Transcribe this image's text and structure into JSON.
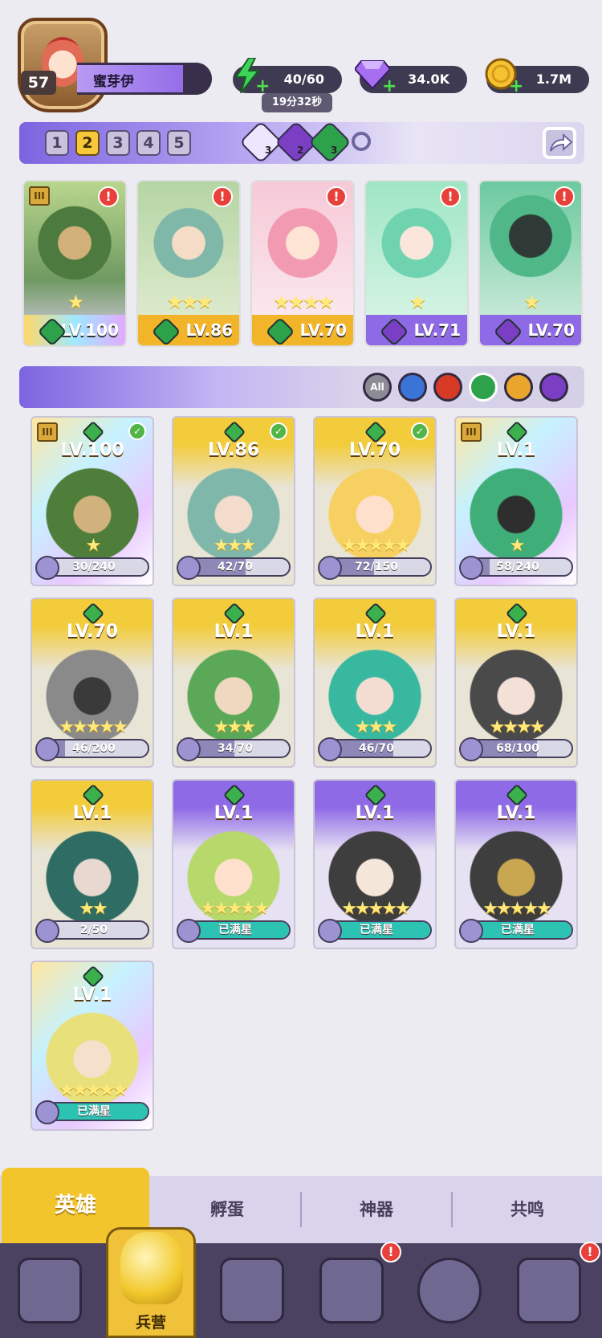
{
  "player": {
    "level": "57",
    "name": "蜜芽伊"
  },
  "resources": {
    "energy": "40/60",
    "energy_timer": "19分32秒",
    "gems": "34.0K",
    "coins": "1.7M"
  },
  "team_slots": [
    "1",
    "2",
    "3",
    "4",
    "5"
  ],
  "team_elements": [
    {
      "icon": "light-element-icon",
      "count": "3"
    },
    {
      "icon": "dark-element-icon",
      "count": "2"
    },
    {
      "icon": "nature-element-icon",
      "count": "3"
    }
  ],
  "team": [
    {
      "level": "LV.100",
      "element": "nature",
      "stars": "★",
      "rank": "III",
      "alert": "!"
    },
    {
      "level": "LV.86",
      "element": "nature",
      "stars": "★★★",
      "alert": "!"
    },
    {
      "level": "LV.70",
      "element": "nature",
      "stars": "★★★★",
      "alert": "!"
    },
    {
      "level": "LV.71",
      "element": "dark",
      "stars": "★",
      "alert": "!"
    },
    {
      "level": "LV.70",
      "element": "dark",
      "stars": "★",
      "alert": "!"
    }
  ],
  "filters": {
    "all_label": "All",
    "colors": {
      "water": "#3a74d6",
      "fire": "#d63a24",
      "nature": "#2da24a",
      "light": "#e8a72c",
      "dark": "#7b3fc4"
    }
  },
  "heroes": [
    {
      "level": "LV.100",
      "progress": "30/240",
      "fraction": 0.125,
      "stars": "★",
      "check": true,
      "rank": "III",
      "frame": "holo"
    },
    {
      "level": "LV.86",
      "progress": "42/70",
      "fraction": 0.6,
      "stars": "★★★",
      "check": true,
      "frame": "gold"
    },
    {
      "level": "LV.70",
      "progress": "72/150",
      "fraction": 0.48,
      "stars": "★★★★★",
      "check": true,
      "frame": "gold"
    },
    {
      "level": "LV.1",
      "progress": "58/240",
      "fraction": 0.24,
      "stars": "★",
      "rank": "III",
      "frame": "holo"
    },
    {
      "level": "LV.70",
      "progress": "46/200",
      "fraction": 0.23,
      "stars": "★★★★★",
      "frame": "gold"
    },
    {
      "level": "LV.1",
      "progress": "34/70",
      "fraction": 0.49,
      "stars": "★★★",
      "frame": "gold"
    },
    {
      "level": "LV.1",
      "progress": "46/70",
      "fraction": 0.66,
      "stars": "★★★",
      "frame": "gold"
    },
    {
      "level": "LV.1",
      "progress": "68/100",
      "fraction": 0.68,
      "stars": "★★★★",
      "frame": "gold"
    },
    {
      "level": "LV.1",
      "progress": "2/50",
      "fraction": 0.04,
      "stars": "★★",
      "frame": "gold"
    },
    {
      "level": "LV.1",
      "progress": "已满星",
      "fraction": 1,
      "stars": "★★★★★",
      "frame": "purple",
      "full": true
    },
    {
      "level": "LV.1",
      "progress": "已满星",
      "fraction": 1,
      "stars": "★★★★★",
      "frame": "purple",
      "full": true
    },
    {
      "level": "LV.1",
      "progress": "已满星",
      "fraction": 1,
      "stars": "★★★★★",
      "frame": "purple",
      "full": true
    },
    {
      "level": "LV.1",
      "progress": "已满星",
      "fraction": 1,
      "stars": "★★★★★",
      "frame": "holo",
      "full": true
    }
  ],
  "tabs": {
    "hero": "英雄",
    "hatch": "孵蛋",
    "artifact": "神器",
    "resonance": "共鸣"
  },
  "nav": {
    "barracks_label": "兵营",
    "alert": "!"
  }
}
